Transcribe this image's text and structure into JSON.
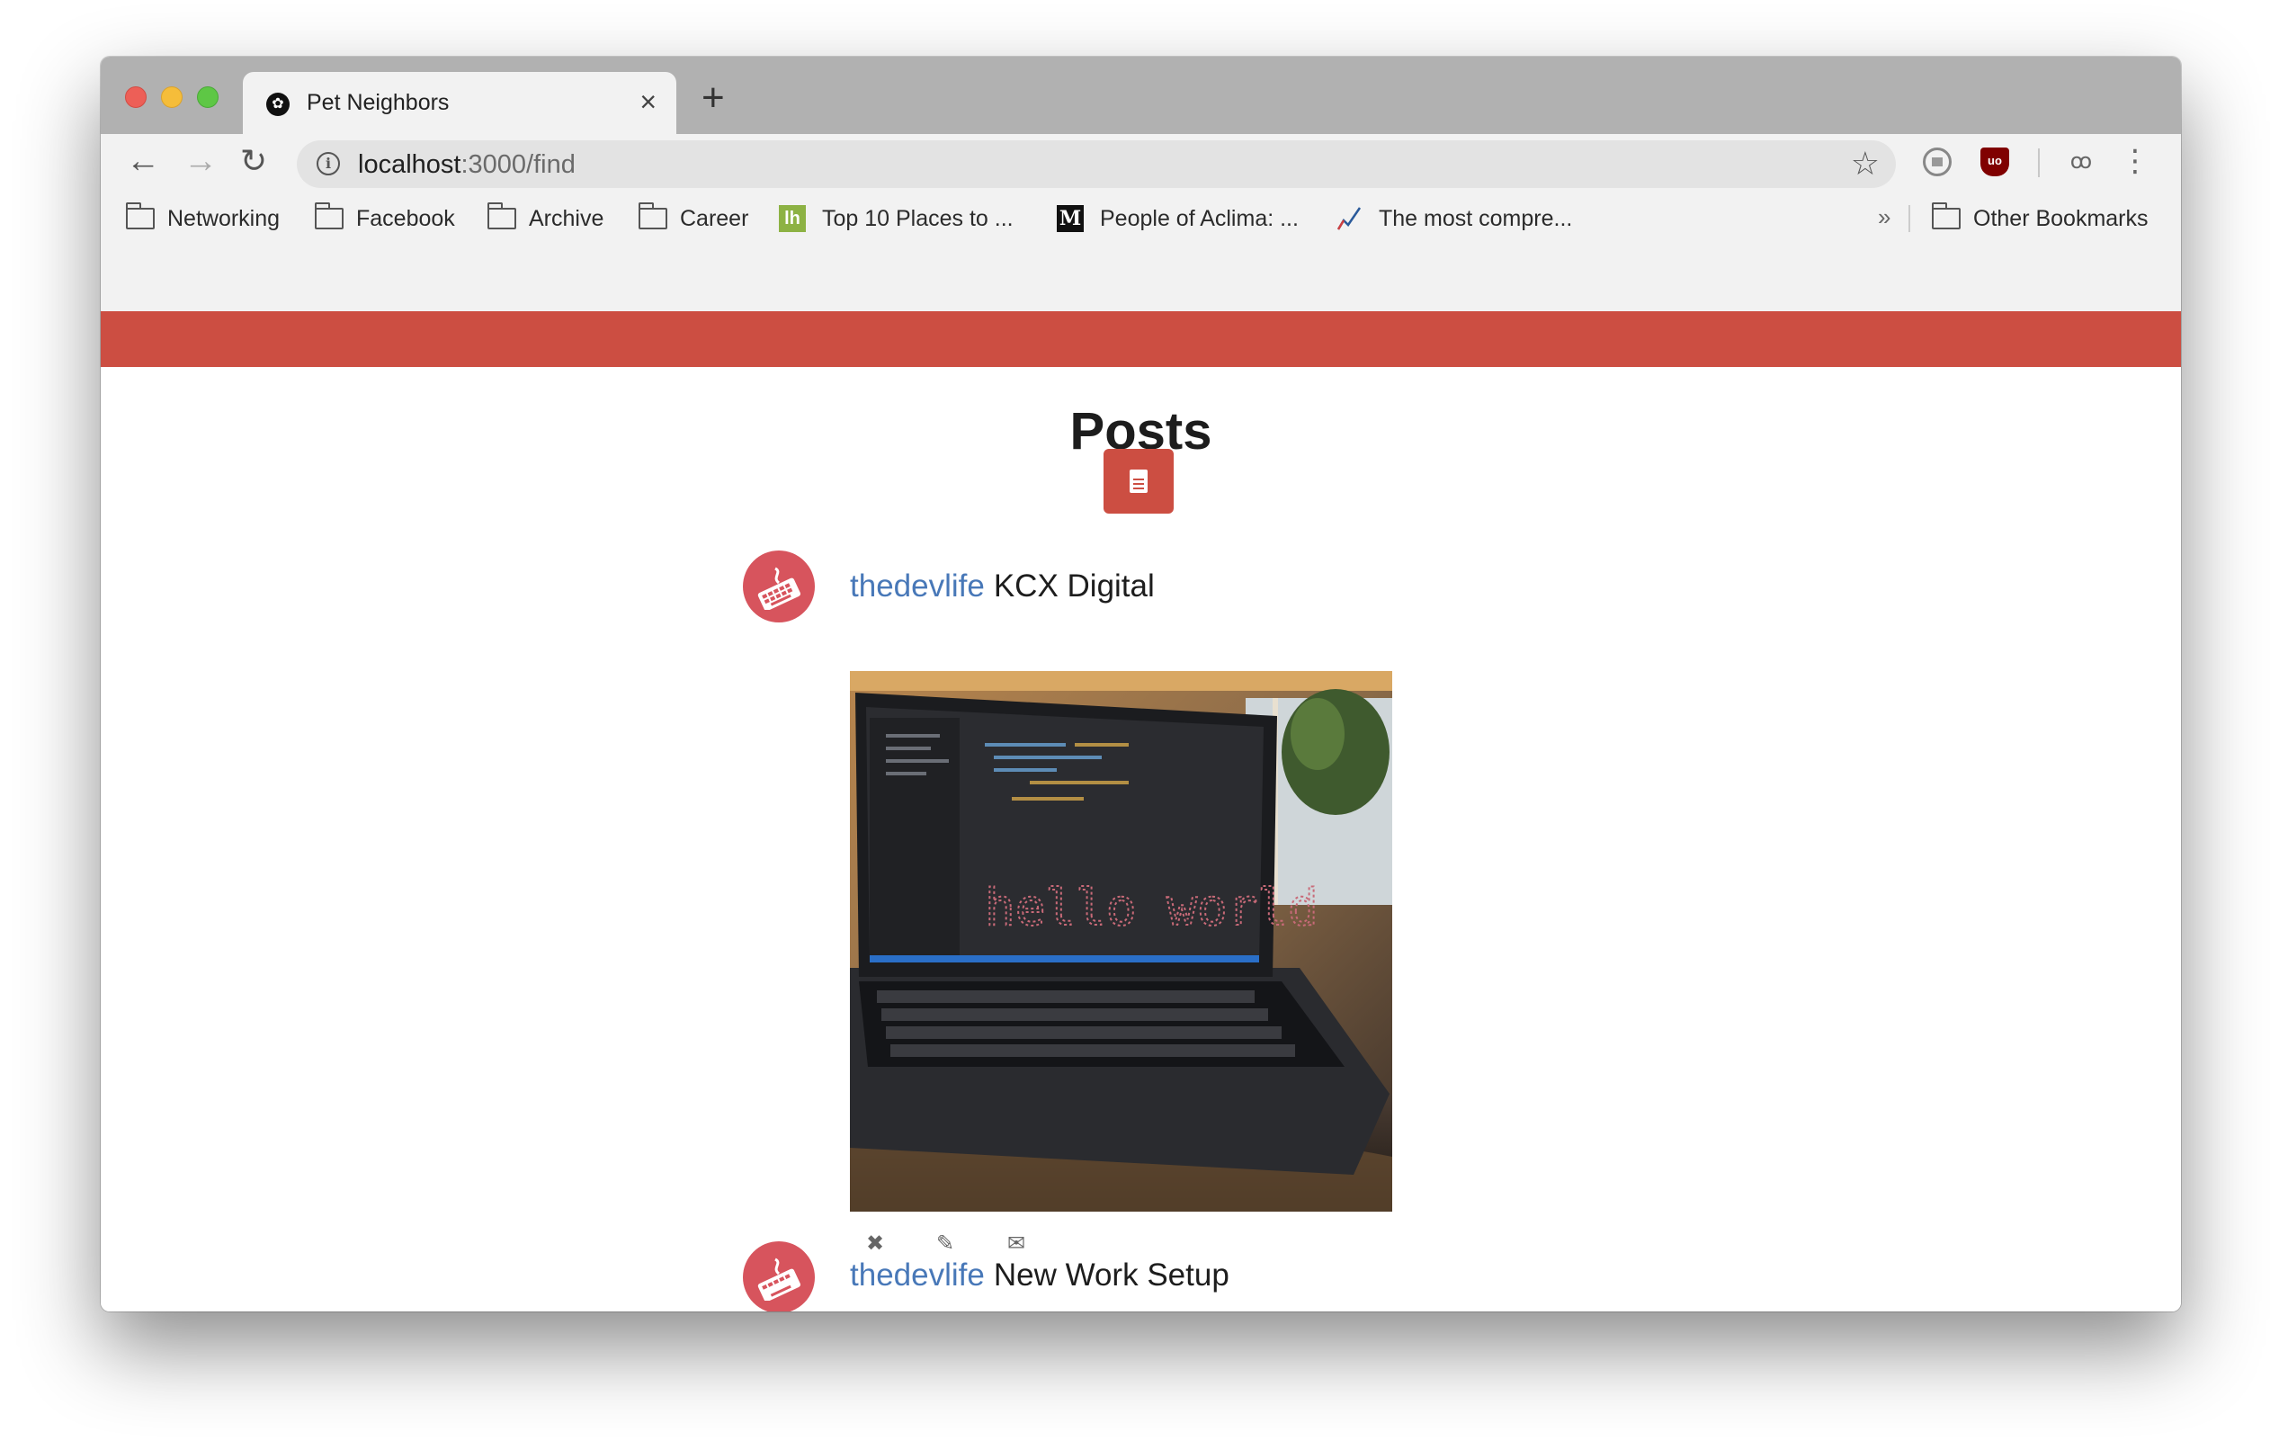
{
  "browser": {
    "tab_title": "Pet Neighbors",
    "tab_close": "×",
    "new_tab": "+",
    "nav": {
      "back": "←",
      "forward": "→",
      "reload": "↻"
    },
    "url_host": "localhost",
    "url_path": ":3000/find",
    "star": "☆",
    "menu": "⋮",
    "bookmarks": [
      {
        "label": "Networking",
        "icon": "folder-icon"
      },
      {
        "label": "Facebook",
        "icon": "folder-icon"
      },
      {
        "label": "Archive",
        "icon": "folder-icon"
      },
      {
        "label": "Career",
        "icon": "folder-icon"
      },
      {
        "label": "Top 10 Places to ...",
        "icon": "lh-icon"
      },
      {
        "label": "People of Aclima: ...",
        "icon": "medium-icon"
      },
      {
        "label": "The most compre...",
        "icon": "chart-icon"
      }
    ],
    "bookmarks_more": "»",
    "other_bookmarks": "Other Bookmarks"
  },
  "page": {
    "heading": "Posts",
    "accent": "#cc4e42",
    "posts": [
      {
        "username": "thedevlife",
        "title": "KCX Digital",
        "screen_text": "hello world",
        "actions": [
          {
            "label": "✖",
            "icon": "delete-icon"
          },
          {
            "label": "✎",
            "icon": "edit-icon"
          },
          {
            "label": "✉",
            "icon": "mail-icon"
          }
        ]
      },
      {
        "username": "thedevlife",
        "title": "New Work Setup"
      }
    ]
  }
}
